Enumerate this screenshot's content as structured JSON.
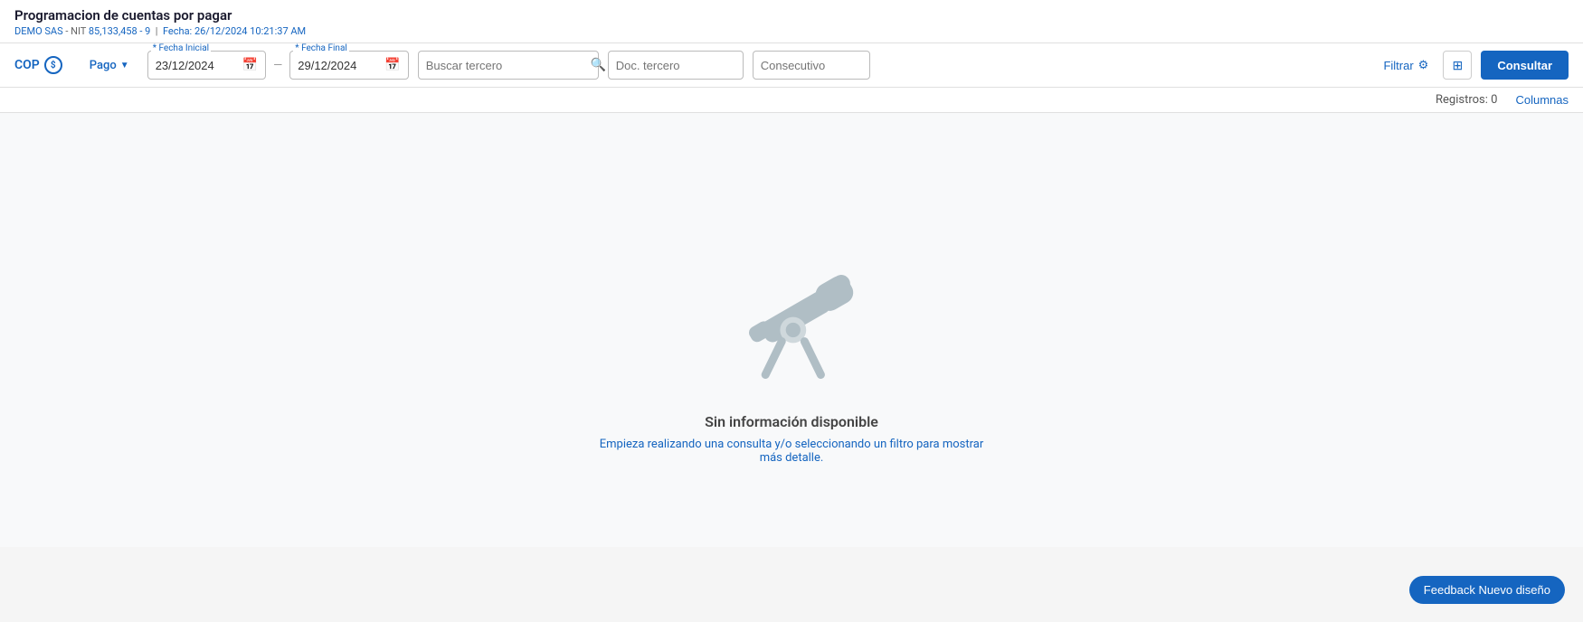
{
  "header": {
    "title": "Programacion de cuentas por pagar",
    "company": "DEMO SAS",
    "nit": "85,133,458 - 9",
    "fecha_label": "Fecha:",
    "fecha_value": "26/12/2024 10:21:37 AM"
  },
  "toolbar": {
    "currency_label": "COP",
    "currency_symbol": "$",
    "pago_label": "Pago",
    "fecha_inicial_label": "* Fecha Inicial",
    "fecha_inicial_value": "23/12/2024",
    "fecha_final_label": "* Fecha Final",
    "fecha_final_value": "29/12/2024",
    "search_placeholder": "Buscar tercero",
    "doc_placeholder": "Doc. tercero",
    "consec_placeholder": "Consecutivo",
    "filtrar_label": "Filtrar",
    "consultar_label": "Consultar"
  },
  "records_bar": {
    "label": "Registros:",
    "count": "0",
    "columns_label": "Columnas"
  },
  "empty_state": {
    "title": "Sin información disponible",
    "subtitle": "Empieza realizando una consulta y/o seleccionando un filtro para mostrar más detalle."
  },
  "feedback": {
    "label": "Feedback Nuevo diseño"
  }
}
